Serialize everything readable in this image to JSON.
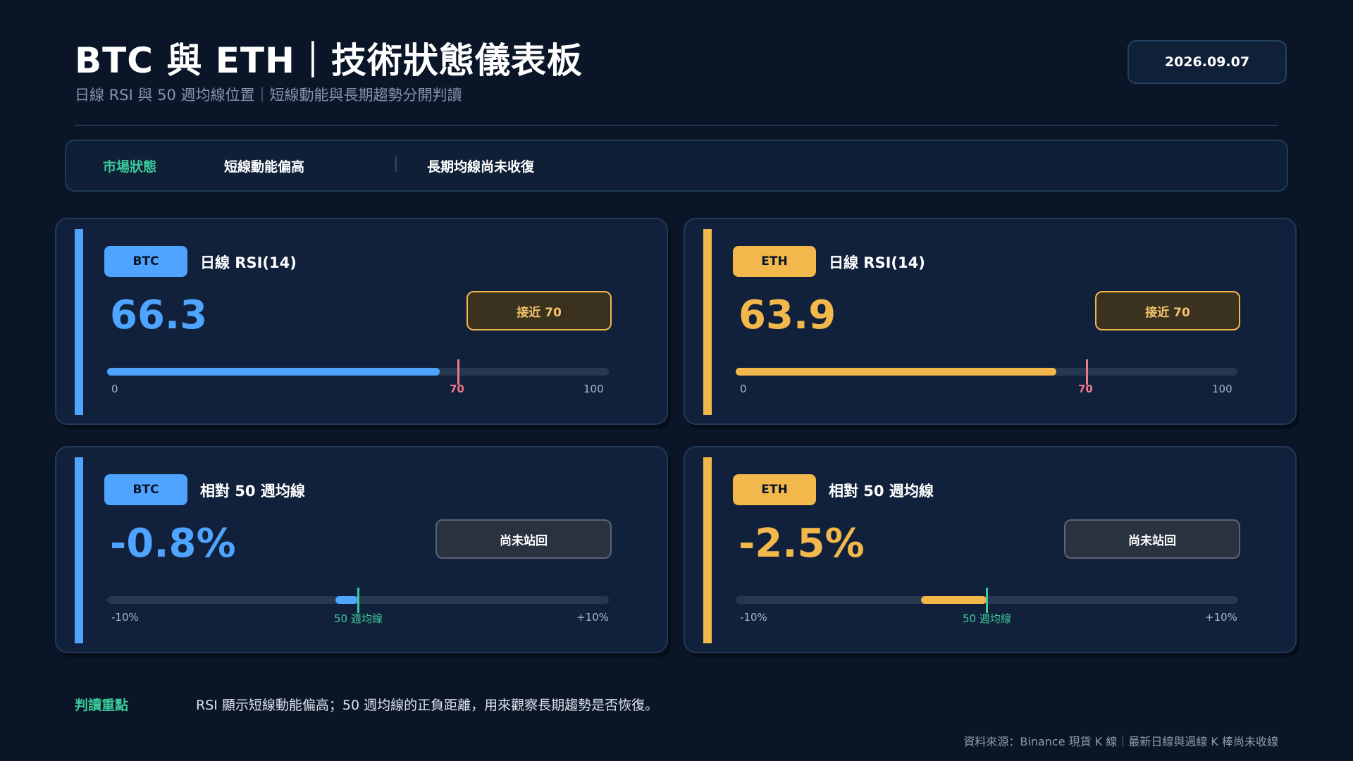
{
  "header": {
    "title": "BTC 與 ETH｜技術狀態儀表板",
    "subtitle": "日線 RSI 與 50 週均線位置｜短線動能與長期趨勢分開判讀",
    "date": "2026.09.07"
  },
  "status_bar": {
    "label": "市場狀態",
    "item_1": "短線動能偏高",
    "divider": "|",
    "item_2": "長期均線尚未收復"
  },
  "colors": {
    "btc": "#4ea4ff",
    "eth": "#f2b84b",
    "rsi_marker": "#f07a8a",
    "ma_marker": "#3cc99a"
  },
  "cards": {
    "btc_rsi": {
      "tag": "BTC",
      "title": "日線 RSI(14)",
      "value": "66.3",
      "badge": "接近 70",
      "fill_fraction": 0.663,
      "marker_fraction": 0.7,
      "axis_min": "0",
      "axis_mid": "70",
      "axis_max": "100"
    },
    "eth_rsi": {
      "tag": "ETH",
      "title": "日線 RSI(14)",
      "value": "63.9",
      "badge": "接近 70",
      "fill_fraction": 0.639,
      "marker_fraction": 0.7,
      "axis_min": "0",
      "axis_mid": "70",
      "axis_max": "100"
    },
    "btc_ma": {
      "tag": "BTC",
      "title": "相對 50 週均線",
      "value": "-0.8%",
      "badge": "尚未站回",
      "deviation_pct": -0.8,
      "axis_min": "-10%",
      "axis_mid": "50 週均線",
      "axis_max": "+10%"
    },
    "eth_ma": {
      "tag": "ETH",
      "title": "相對 50 週均線",
      "value": "-2.5%",
      "badge": "尚未站回",
      "deviation_pct": -2.5,
      "axis_min": "-10%",
      "axis_mid": "50 週均線",
      "axis_max": "+10%"
    }
  },
  "note": {
    "label": "判讀重點",
    "text": "RSI 顯示短線動能偏高；50 週均線的正負距離，用來觀察長期趨勢是否恢復。"
  },
  "source": "資料來源：Binance 現貨 K 線｜最新日線與週線 K 棒尚未收線"
}
